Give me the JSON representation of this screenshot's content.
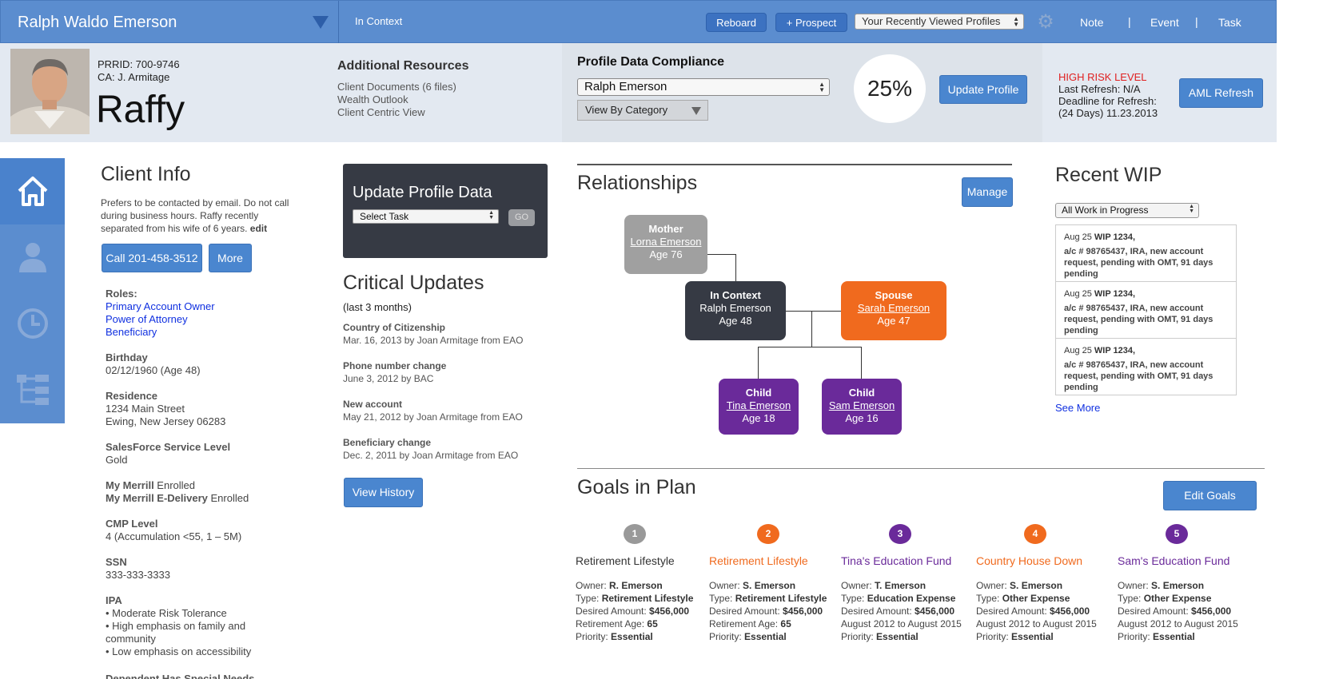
{
  "topbar": {
    "client_name": "Ralph Waldo Emerson",
    "context_label": "In Context",
    "reboard_label": "Reboard",
    "prospect_label": "+ Prospect",
    "recent_profiles_select": "Your Recently Viewed Profiles",
    "note_label": "Note",
    "event_label": "Event",
    "task_label": "Task",
    "separator": "|"
  },
  "profile": {
    "prrid": "PRRID: 700-9746",
    "ca": "CA: J. Armitage",
    "nickname": "Raffy"
  },
  "additional_resources": {
    "title": "Additional Resources",
    "items": [
      "Client Documents (6 files)",
      "Wealth Outlook",
      "Client Centric View"
    ]
  },
  "compliance": {
    "title": "Profile Data Compliance",
    "selected_client": "Ralph Emerson",
    "view_select": "View By Category",
    "percent": "25%",
    "update_button": "Update Profile"
  },
  "risk": {
    "level": "HIGH RISK LEVEL",
    "last_refresh": "Last Refresh:  N/A",
    "deadline_label": "Deadline for Refresh:",
    "deadline_value": "(24 Days) 11.23.2013",
    "aml_button": "AML Refresh"
  },
  "client_info": {
    "title": "Client Info",
    "note": "Prefers to be contacted by email. Do not call during business hours. Raffy recently separated from his wife of 6 years.",
    "edit_link": "edit",
    "call_button": "Call 201-458-3512",
    "more_button": "More",
    "roles_label": "Roles:",
    "roles": [
      "Primary Account Owner",
      "Power of Attorney",
      "Beneficiary"
    ],
    "birthday_label": "Birthday",
    "birthday_value": "02/12/1960  (Age 48)",
    "residence_label": "Residence",
    "residence_line1": "1234 Main Street",
    "residence_line2": "Ewing, New Jersey 06283",
    "sf_label": "SalesForce Service Level",
    "sf_value": "Gold",
    "mymerrill_label": "My Merrill",
    "mymerrill_value": " Enrolled",
    "edelivery_label": "My Merrill E-Delivery",
    "edelivery_value": " Enrolled",
    "cmp_label": "CMP Level",
    "cmp_value": "4 (Accumulation <55, 1 – 5M)",
    "ssn_label": "SSN",
    "ssn_value": "333-333-3333",
    "ipa_label": "IPA",
    "ipa_items": [
      "• Moderate Risk Tolerance",
      "• High emphasis on family and community",
      "• Low emphasis on accessibility"
    ],
    "dependent_label": "Dependent Has Special Needs"
  },
  "update_profile": {
    "title": "Update Profile Data",
    "select_task": "Select Task",
    "go_label": "GO"
  },
  "critical_updates": {
    "title": "Critical Updates",
    "subtitle": "(last 3 months)",
    "items": [
      {
        "label": "Country of Citizenship",
        "detail": "Mar. 16, 2013 by Joan Armitage from EAO"
      },
      {
        "label": "Phone number change",
        "detail": "June 3, 2012 by BAC"
      },
      {
        "label": "New account",
        "detail": "May 21, 2012 by Joan Armitage  from EAO"
      },
      {
        "label": "Beneficiary change",
        "detail": "Dec. 2, 2011 by Joan Armitage  from EAO"
      }
    ],
    "history_button": "View History"
  },
  "relationships": {
    "title": "Relationships",
    "manage_button": "Manage",
    "mother": {
      "role": "Mother",
      "name": "Lorna Emerson",
      "age": "Age 76"
    },
    "self": {
      "role": "In Context",
      "name": "Ralph Emerson",
      "age": "Age 48"
    },
    "spouse": {
      "role": "Spouse",
      "name": "Sarah Emerson",
      "age": "Age 47"
    },
    "child1": {
      "role": "Child",
      "name": "Tina Emerson",
      "age": "Age 18"
    },
    "child2": {
      "role": "Child",
      "name": "Sam Emerson",
      "age": "Age 16"
    }
  },
  "recent_wip": {
    "title": "Recent WIP",
    "filter": "All Work in Progress",
    "items": [
      {
        "date": "Aug 25 ",
        "id": "WIP 1234,",
        "desc": "a/c # 98765437, IRA, new account request, pending with OMT, 91 days pending"
      },
      {
        "date": "Aug 25 ",
        "id": "WIP 1234,",
        "desc": "a/c # 98765437, IRA, new account request, pending with OMT, 91 days pending"
      },
      {
        "date": "Aug 25 ",
        "id": "WIP 1234,",
        "desc": "a/c # 98765437, IRA, new account request, pending with OMT, 91 days pending"
      }
    ],
    "see_more": "See More"
  },
  "goals": {
    "title": "Goals in Plan",
    "edit_button": "Edit Goals",
    "items": [
      {
        "num": "1",
        "name": "Retirement Lifestyle",
        "color": "#999999",
        "owner": "R. Emerson",
        "type": "Retirement Lifestyle",
        "amount": "$456,000",
        "line4_label": "Retirement Age: ",
        "line4_value": "65",
        "priority": "Essential"
      },
      {
        "num": "2",
        "name": "Retirement Lifestyle",
        "color": "#f06a1e",
        "owner": "S. Emerson",
        "type": "Retirement Lifestyle",
        "amount": "$456,000",
        "line4_label": "Retirement Age: ",
        "line4_value": "65",
        "priority": "Essential"
      },
      {
        "num": "3",
        "name": "Tina's Education Fund",
        "color": "#6a2a9a",
        "owner": "T. Emerson",
        "type": "Education Expense",
        "amount": "$456,000",
        "line4_label": "August 2012 to August 2015",
        "line4_value": "",
        "priority": "Essential"
      },
      {
        "num": "4",
        "name": "Country House Down",
        "color": "#f06a1e",
        "owner": "S. Emerson",
        "type": "Other Expense",
        "amount": "$456,000",
        "line4_label": "August 2012 to August 2015",
        "line4_value": "",
        "priority": "Essential"
      },
      {
        "num": "5",
        "name": "Sam's Education Fund",
        "color": "#6a2a9a",
        "owner": "S. Emerson",
        "type": "Other Expense",
        "amount": "$456,000",
        "line4_label": "August 2012 to August 2015",
        "line4_value": "",
        "priority": "Essential"
      }
    ],
    "owner_label": "Owner: ",
    "type_label": "Type: ",
    "amount_label": "Desired Amount: ",
    "priority_label": "Priority: "
  },
  "icons": [
    "chevron-down-icon",
    "gear-icon",
    "home-icon",
    "person-icon",
    "clock-icon",
    "hierarchy-icon"
  ]
}
